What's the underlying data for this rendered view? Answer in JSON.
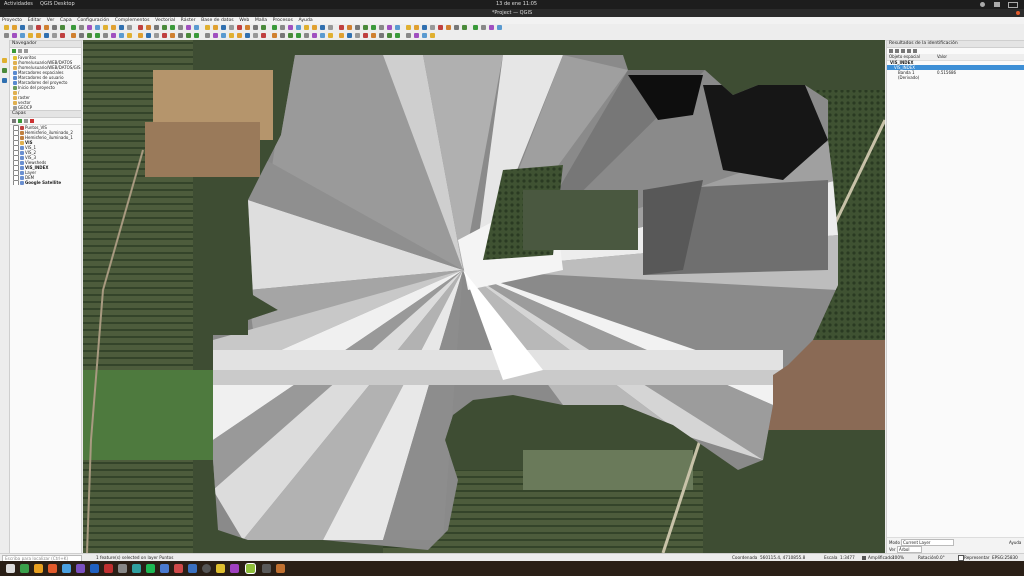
{
  "system_bar": {
    "activities": "Actividades",
    "app": "QGIS Desktop",
    "clock": "13 de ene  11:05"
  },
  "window": {
    "title": "*Project — QGIS"
  },
  "menu": [
    "Proyecto",
    "Editar",
    "Ver",
    "Capa",
    "Configuración",
    "Complementos",
    "Vectorial",
    "Ráster",
    "Base de datos",
    "Web",
    "Malla",
    "Procesos",
    "Ayuda"
  ],
  "browser_panel": {
    "title": "Navegador",
    "items": [
      {
        "label": "Favoritos",
        "icon": "star-icon"
      },
      {
        "label": "/home/usuario/WEB/DATOS",
        "icon": "folder-icon"
      },
      {
        "label": "/home/usuario/WEB/DATOS/GIS",
        "icon": "folder-icon"
      },
      {
        "label": "Marcadores espaciales",
        "icon": "bookmark-icon"
      },
      {
        "label": "Marcadores de usuario",
        "icon": "bookmark-icon"
      },
      {
        "label": "Marcadores del proyecto",
        "icon": "bookmark-icon"
      },
      {
        "label": "Inicio del proyecto",
        "icon": "home-icon"
      },
      {
        "label": "/",
        "icon": "folder-icon"
      },
      {
        "label": "raster",
        "icon": "folder-icon"
      },
      {
        "label": "vector",
        "icon": "folder-icon"
      },
      {
        "label": "GEOCP",
        "icon": "file-icon"
      },
      {
        "label": "VIS_INDEX.tif",
        "icon": "raster-icon",
        "selected": true
      }
    ]
  },
  "layers_panel": {
    "title": "Capas",
    "items": [
      {
        "label": "Puntos_VIS",
        "icon": "point-layer-icon"
      },
      {
        "label": "Hemisferio_iluminado_2",
        "icon": "polygon-layer-icon"
      },
      {
        "label": "Hemisferio_iluminado_1",
        "icon": "polygon-layer-icon"
      },
      {
        "label": "VIS",
        "icon": "group-icon",
        "bold": true
      },
      {
        "label": "VIS_1",
        "icon": "raster-icon"
      },
      {
        "label": "VIS_2",
        "icon": "raster-icon"
      },
      {
        "label": "VIS_3",
        "icon": "raster-icon"
      },
      {
        "label": "Viewsheds",
        "icon": "raster-icon"
      },
      {
        "label": "VIS_INDEX",
        "icon": "raster-icon",
        "bold": true
      },
      {
        "label": "Layer",
        "icon": "raster-icon"
      },
      {
        "label": "DEM",
        "icon": "raster-icon"
      },
      {
        "label": "Google Satellite",
        "icon": "raster-icon",
        "bold": true
      }
    ]
  },
  "identify_panel": {
    "title": "Resultados de la identificación",
    "col_feature": "Objeto espacial",
    "col_value": "Valor",
    "rows": [
      {
        "feature": "VIS_INDEX",
        "value": "",
        "indent": 0,
        "bold": true
      },
      {
        "feature": "VIS_INDEX",
        "value": "",
        "indent": 1,
        "selected": true
      },
      {
        "feature": "Banda 1",
        "value": "0.515686",
        "indent": 2
      },
      {
        "feature": "(Derivado)",
        "value": "",
        "indent": 2
      }
    ],
    "mode_label": "Modo",
    "mode_value": "Current Layer",
    "view_label": "Ver",
    "view_value": "Árbol",
    "help_label": "Ayuda"
  },
  "status": {
    "search_placeholder": "Escriba para localizar (Ctrl+K)",
    "message": "1 feature(s) selected on layer Puntos",
    "coord_label": "Coordenada",
    "coord_value": "560115.4, 4710855.8",
    "scale_label": "Escala",
    "scale_value": "1:3477",
    "magnifier_label": "Amplificador",
    "magnifier_value": "100%",
    "rotation_label": "Rotación",
    "rotation_value": "0.0°",
    "render_label": "Representar",
    "crs": "EPSG:25830"
  },
  "colors": {
    "accent": "#3d8fd6",
    "dock_bg": "#2a1f16",
    "titlebar_bg": "#2b2b2b"
  }
}
